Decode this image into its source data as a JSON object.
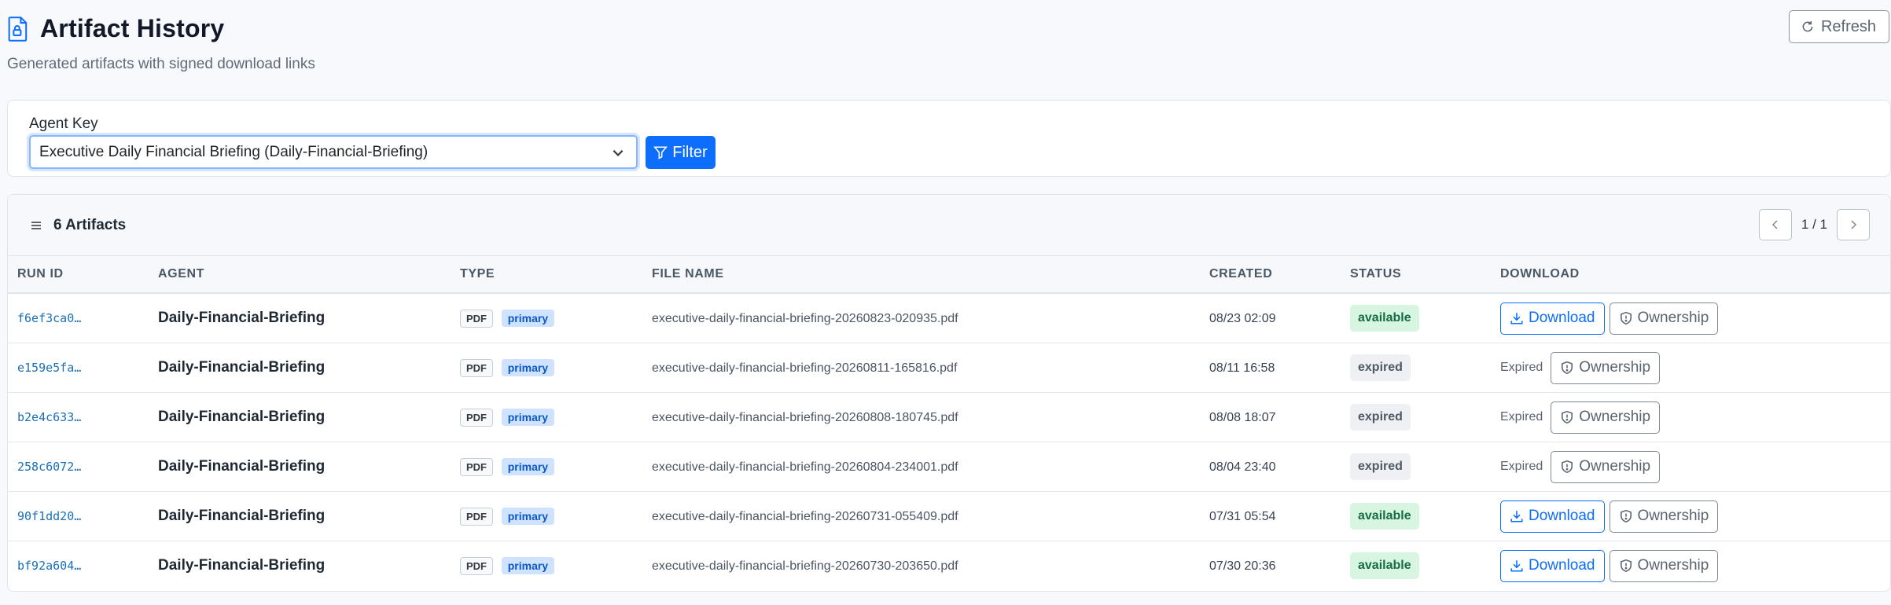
{
  "header": {
    "title": "Artifact History",
    "subtitle": "Generated artifacts with signed download links",
    "refresh_label": "Refresh"
  },
  "filter": {
    "label": "Agent Key",
    "selected": "Executive Daily Financial Briefing (Daily-Financial-Briefing)",
    "button_label": "Filter"
  },
  "table": {
    "count_label": "6 Artifacts",
    "pager_text": "1 / 1",
    "columns": [
      "RUN ID",
      "AGENT",
      "TYPE",
      "FILE NAME",
      "CREATED",
      "STATUS",
      "DOWNLOAD"
    ],
    "download_label": "Download",
    "ownership_label": "Ownership",
    "expired_label": "Expired",
    "rows": [
      {
        "run_id": "f6ef3ca0…",
        "agent": "Daily-Financial-Briefing",
        "type": "PDF",
        "role": "primary",
        "file_name": "executive-daily-financial-briefing-20260823-020935.pdf",
        "created": "08/23 02:09",
        "status": "available"
      },
      {
        "run_id": "e159e5fa…",
        "agent": "Daily-Financial-Briefing",
        "type": "PDF",
        "role": "primary",
        "file_name": "executive-daily-financial-briefing-20260811-165816.pdf",
        "created": "08/11 16:58",
        "status": "expired"
      },
      {
        "run_id": "b2e4c633…",
        "agent": "Daily-Financial-Briefing",
        "type": "PDF",
        "role": "primary",
        "file_name": "executive-daily-financial-briefing-20260808-180745.pdf",
        "created": "08/08 18:07",
        "status": "expired"
      },
      {
        "run_id": "258c6072…",
        "agent": "Daily-Financial-Briefing",
        "type": "PDF",
        "role": "primary",
        "file_name": "executive-daily-financial-briefing-20260804-234001.pdf",
        "created": "08/04 23:40",
        "status": "expired"
      },
      {
        "run_id": "90f1dd20…",
        "agent": "Daily-Financial-Briefing",
        "type": "PDF",
        "role": "primary",
        "file_name": "executive-daily-financial-briefing-20260731-055409.pdf",
        "created": "07/31 05:54",
        "status": "available"
      },
      {
        "run_id": "bf92a604…",
        "agent": "Daily-Financial-Briefing",
        "type": "PDF",
        "role": "primary",
        "file_name": "executive-daily-financial-briefing-20260730-203650.pdf",
        "created": "07/30 20:36",
        "status": "available"
      }
    ]
  },
  "colors": {
    "accent": "#0d6efd",
    "available_bg": "#d8f5e1",
    "expired_bg": "#eef0f3"
  },
  "icons": {
    "title": "file-lock-icon",
    "refresh": "refresh-icon",
    "filter": "funnel-icon",
    "select": "chevron-down-icon",
    "list": "list-icon",
    "download": "download-icon",
    "ownership": "shield-icon"
  }
}
